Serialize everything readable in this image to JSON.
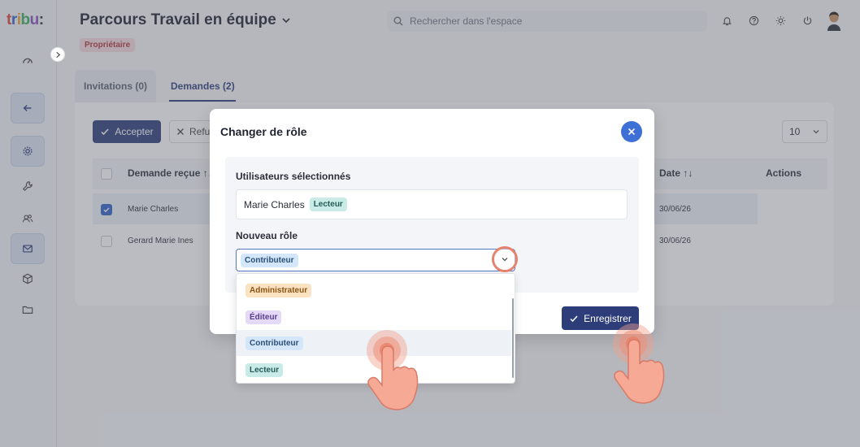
{
  "logo": {
    "text": "tribu:"
  },
  "header": {
    "title": "Parcours Travail en équipe",
    "owner_badge": "Propriétaire",
    "search_placeholder": "Rechercher dans l'espace"
  },
  "tabs": [
    {
      "label": "Invitations (0)"
    },
    {
      "label": "Demandes (2)"
    }
  ],
  "toolbar": {
    "accept_label": "Accepter",
    "refuse_label": "Refu",
    "page_size": "10"
  },
  "table": {
    "headers": {
      "request": "Demande reçue ↑↓",
      "date": "Date ↑↓",
      "actions": "Actions"
    },
    "rows": [
      {
        "name": "Marie Charles",
        "date": "30/06/26",
        "checked": true
      },
      {
        "name": "Gerard Marie Ines",
        "date": "30/06/26",
        "checked": false
      }
    ]
  },
  "modal": {
    "title": "Changer de rôle",
    "selected_users_label": "Utilisateurs sélectionnés",
    "selected_user": {
      "name": "Marie Charles",
      "role": "Lecteur"
    },
    "new_role_label": "Nouveau rôle",
    "selected_role": "Contributeur",
    "save_label": "Enregistrer",
    "options": [
      {
        "label": "Administrateur"
      },
      {
        "label": "Éditeur"
      },
      {
        "label": "Contributeur"
      },
      {
        "label": "Lecteur"
      }
    ]
  },
  "colors": {
    "primary": "#2d3d7a",
    "accent_blue": "#3d6fd6",
    "highlight_ring": "#e6836e"
  }
}
